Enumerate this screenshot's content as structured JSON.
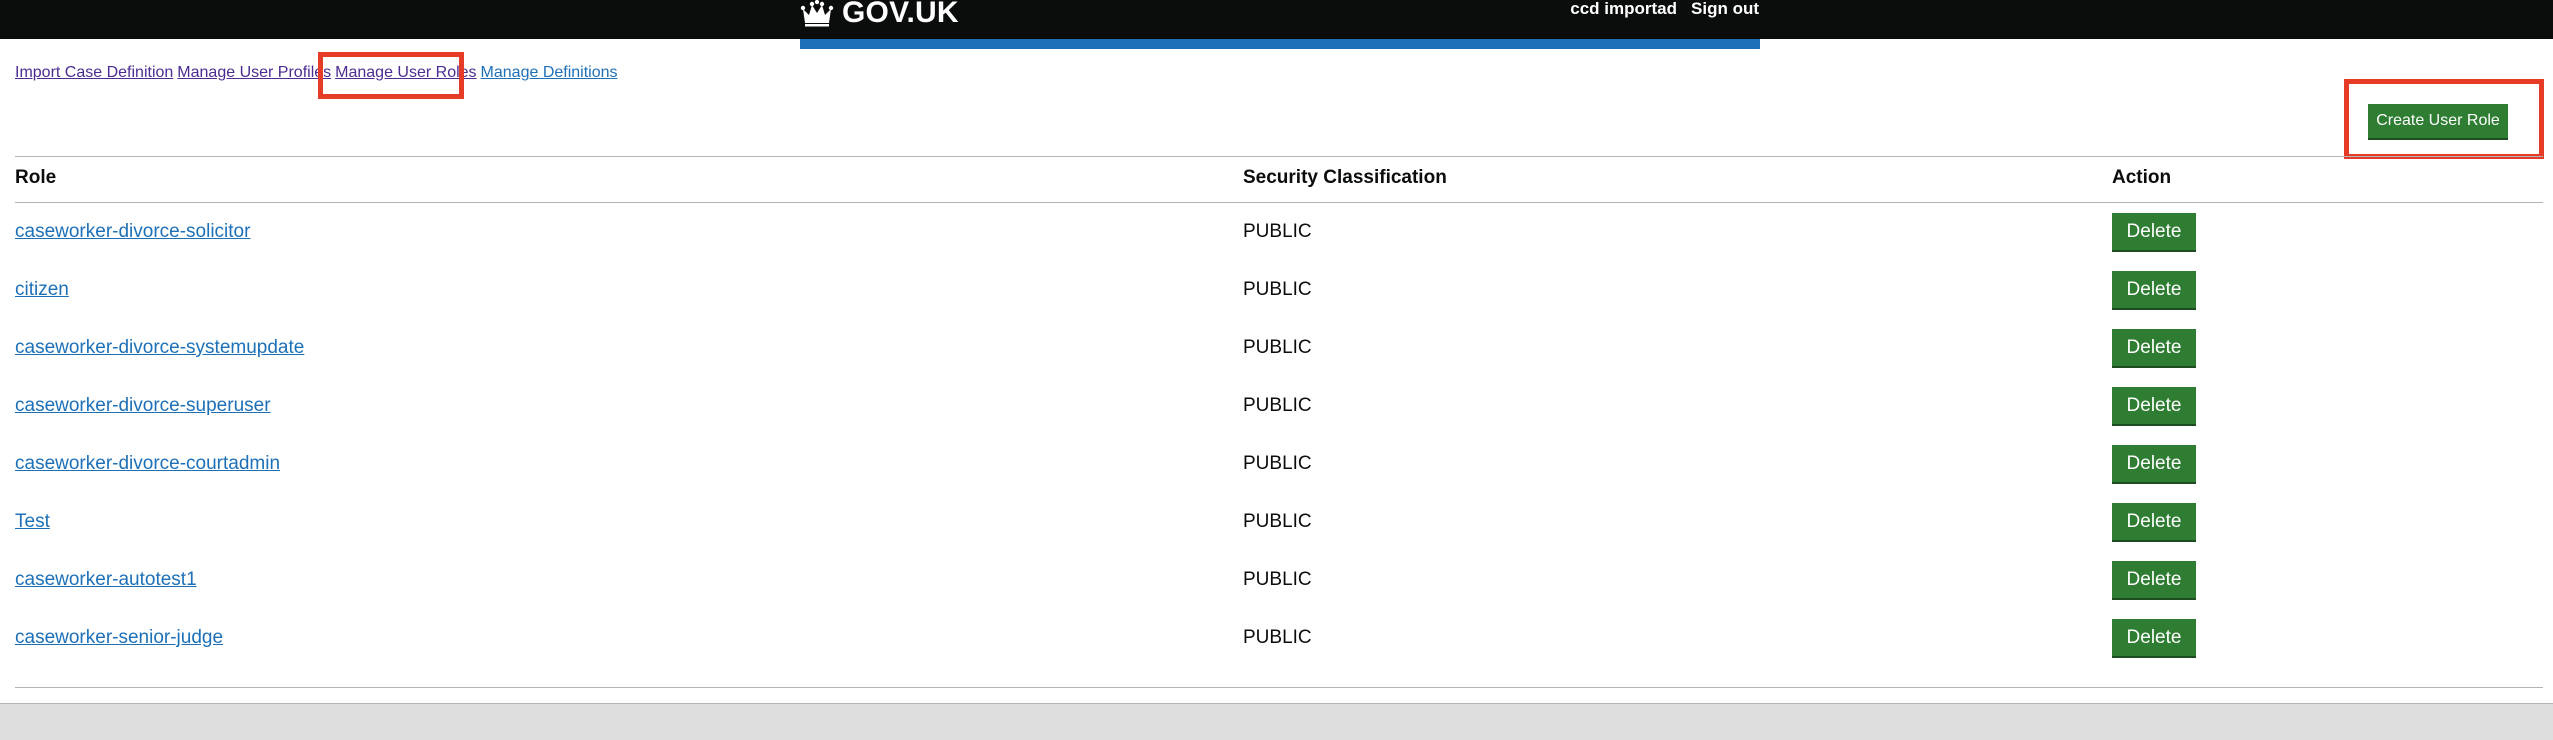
{
  "header": {
    "logo_text": "GOV.UK",
    "user_name": "ccd importad",
    "sign_out": "Sign out"
  },
  "nav": {
    "items": [
      {
        "label": "Import Case Definition"
      },
      {
        "label": "Manage User Profiles"
      },
      {
        "label": "Manage User Roles"
      },
      {
        "label": "Manage Definitions"
      }
    ]
  },
  "actions": {
    "create_user_role": "Create User Role"
  },
  "table": {
    "headers": {
      "role": "Role",
      "security": "Security Classification",
      "action": "Action"
    },
    "rows": [
      {
        "role": "caseworker-divorce-solicitor",
        "security": "PUBLIC",
        "action": "Delete"
      },
      {
        "role": "citizen",
        "security": "PUBLIC",
        "action": "Delete"
      },
      {
        "role": "caseworker-divorce-systemupdate",
        "security": "PUBLIC",
        "action": "Delete"
      },
      {
        "role": "caseworker-divorce-superuser",
        "security": "PUBLIC",
        "action": "Delete"
      },
      {
        "role": "caseworker-divorce-courtadmin",
        "security": "PUBLIC",
        "action": "Delete"
      },
      {
        "role": "Test",
        "security": "PUBLIC",
        "action": "Delete"
      },
      {
        "role": "caseworker-autotest1",
        "security": "PUBLIC",
        "action": "Delete"
      },
      {
        "role": "caseworker-senior-judge",
        "security": "PUBLIC",
        "action": "Delete"
      }
    ]
  },
  "colors": {
    "header_bg": "#0b0c0c",
    "header_bar": "#1d70b8",
    "button_green": "#2e7d32",
    "highlight_red": "#e53b27",
    "link_blue": "#1d70b8",
    "link_visited": "#4c2c92"
  },
  "icons": {
    "logo": "crown-icon"
  }
}
